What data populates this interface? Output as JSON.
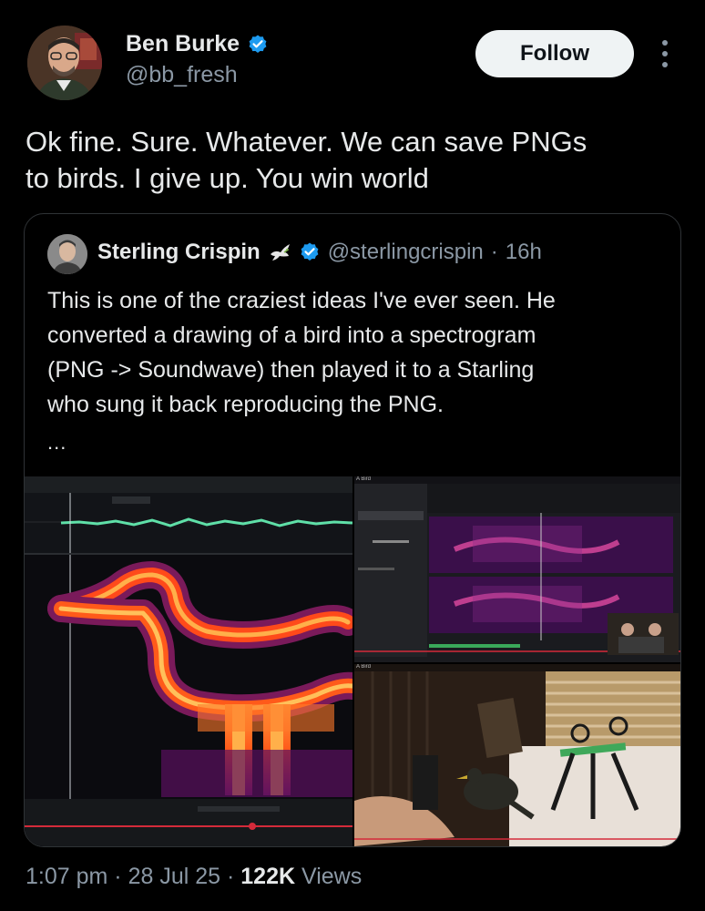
{
  "author": {
    "name": "Ben Burke",
    "handle": "@bb_fresh",
    "verified": true,
    "avatar_icon": "profile-photo"
  },
  "follow_button": {
    "label": "Follow"
  },
  "more_icon": "more-vertical-icon",
  "tweet": {
    "text_line1": "Ok fine. Sure. Whatever. We can save PNGs",
    "text_line2": "to birds. I give up. You win world"
  },
  "quoted_tweet": {
    "name": "Sterling Crispin",
    "emoji_icon": "dove-icon",
    "verified": true,
    "handle": "@sterlingcrispin",
    "separator": "·",
    "time": "16h",
    "text_line1": "This is one of the craziest ideas I've ever seen. He",
    "text_line2": "converted a drawing of a bird into a spectrogram",
    "text_line3": "(PNG -> Soundwave) then played it to a Starling",
    "text_line4": "who sung it back reproducing the PNG.",
    "more": "...",
    "media": {
      "label_top": "A Bird",
      "label_bottom": "A Bird"
    }
  },
  "footer": {
    "time": "1:07 pm",
    "sep1": "·",
    "date": "28 Jul 25",
    "sep2": "·",
    "views_count": "122K",
    "views_label": "Views"
  },
  "colors": {
    "background": "#000000",
    "text_primary": "#e7e9ea",
    "text_secondary": "#8b98a5",
    "verified_blue": "#1d9bf0",
    "border": "#2f3336"
  }
}
